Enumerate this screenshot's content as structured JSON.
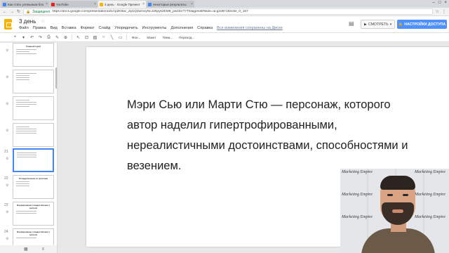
{
  "browser": {
    "tabs": [
      {
        "label": "Как стать успешным бло",
        "color": "#4285f4",
        "active": false
      },
      {
        "label": "YouTube",
        "color": "#e62117",
        "active": false
      },
      {
        "label": "3 день - Google Презент",
        "color": "#f4b400",
        "active": true
      },
      {
        "label": "Некоторые результаты",
        "color": "#4285f4",
        "active": false
      }
    ],
    "secure_label": "Защищено",
    "url": "https://docs.google.com/presentation/d/1Ap2K9ac_Zp1Q2wmxyNcJdhpyk2EM9_pw15V77T5ilqg/edit#slide=id.g2d97182c5e_0_167"
  },
  "docs": {
    "title": "3 день",
    "menu": [
      "Файл",
      "Правка",
      "Вид",
      "Вставка",
      "Формат",
      "Слайд",
      "Упорядочить",
      "Инструменты",
      "Дополнения",
      "Справка"
    ],
    "saved_status": "Все изменения сохранены на Диске",
    "present_label": "СМОТРЕТЬ",
    "share_label": "НАСТРОЙКИ ДОСТУПА"
  },
  "toolbar": {
    "background_label": "Фон...",
    "layout_label": "Макет",
    "theme_label": "Тема...",
    "transition_label": "Переход..."
  },
  "filmstrip": {
    "slides": [
      {
        "num": "",
        "title": "Главный герой"
      },
      {
        "num": "",
        "title": ""
      },
      {
        "num": "",
        "title": ""
      },
      {
        "num": "",
        "title": ""
      },
      {
        "num": "21",
        "title": "",
        "active": true
      },
      {
        "num": "22",
        "title": "Отождествление со зрителем"
      },
      {
        "num": "23",
        "title": "Формирование отождествления у зрителя"
      },
      {
        "num": "24",
        "title": "Формирование отождествления у зрителя"
      }
    ]
  },
  "slide": {
    "body_text": "Мэри Сью или Марти Стю — персонаж, которого автор наделил гипертрофированными, нереалистичными достоинствами, способностями и везением."
  },
  "webcam": {
    "banner_text": "Marketing Empire"
  }
}
